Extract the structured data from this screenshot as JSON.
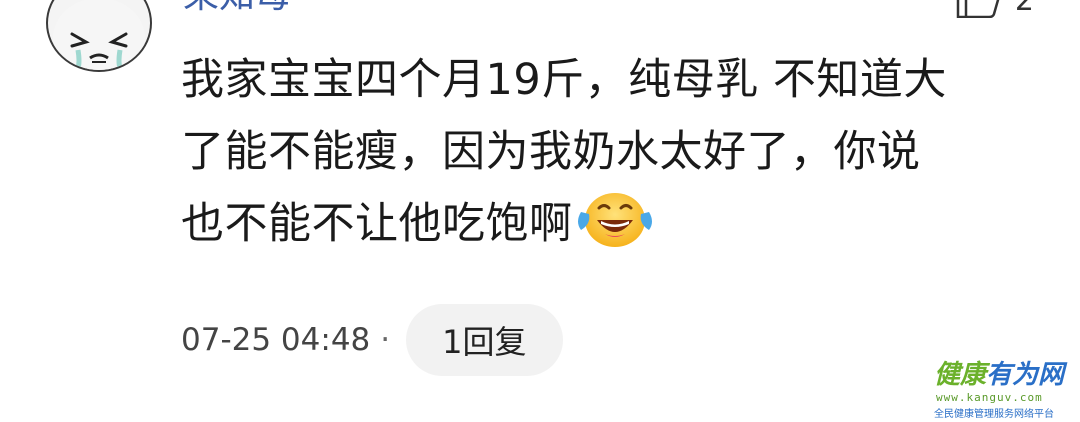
{
  "comment": {
    "username": "呆知母",
    "like_count": "2",
    "text_lines": [
      "我家宝宝四个月19斤，纯母乳 不知道大",
      "了能不能瘦，因为我奶水太好了，你说",
      "也不能不让他吃饱啊"
    ],
    "emoji": "laughing-with-tears-emoji",
    "timestamp": "07-25 04:48",
    "separator": "·",
    "reply_label": "1回复"
  },
  "watermark": {
    "title_part1": "健康",
    "title_part2": "有为网",
    "url": "www.kanguv.com",
    "slogan": "全民健康管理服务网络平台"
  },
  "colors": {
    "username": "#3b5ea8",
    "text": "#1a1a1a",
    "reply_bg": "#f2f2f2",
    "watermark_green": "#6bb12b",
    "watermark_blue": "#2a6fc7"
  }
}
